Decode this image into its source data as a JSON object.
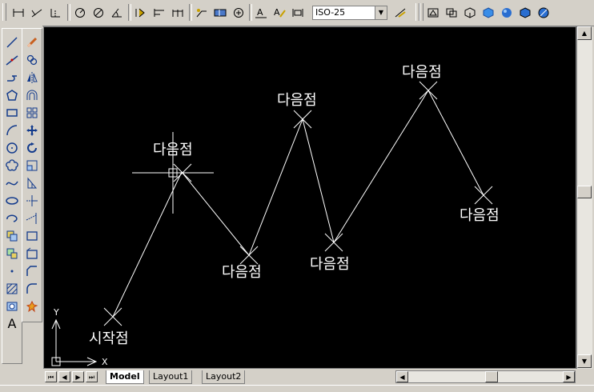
{
  "dimstyle": {
    "value": "ISO-25"
  },
  "toolbar": {
    "icons": [
      "linear-dimension-icon",
      "aligned-dimension-icon",
      "ordinate-dimension-icon",
      "radius-dimension-icon",
      "diameter-dimension-icon",
      "angular-dimension-icon",
      "quick-dimension-icon",
      "baseline-dimension-icon",
      "continue-dimension-icon",
      "leader-icon",
      "tolerance-icon",
      "center-mark-icon",
      "dimension-edit-icon",
      "dimension-text-edit-icon",
      "dimension-update-icon",
      "dimension-style-icon",
      "view-top-icon",
      "view-isometric-icon",
      "wireframe-icon",
      "hidden-icon",
      "flat-shaded-icon",
      "gouraud-shaded-icon",
      "shaded-edges-icon"
    ]
  },
  "draw_toolbar": {
    "text_tool_label": "A"
  },
  "canvas": {
    "labels": {
      "start": "시작점",
      "next1": "다음점",
      "next2": "다음점",
      "next3": "다음점",
      "next4": "다음점",
      "next5": "다음점",
      "next6": "다음점"
    },
    "ucs": {
      "x_label": "X",
      "y_label": "Y"
    }
  },
  "tabs": {
    "model": "Model",
    "layout1": "Layout1",
    "layout2": "Layout2"
  }
}
